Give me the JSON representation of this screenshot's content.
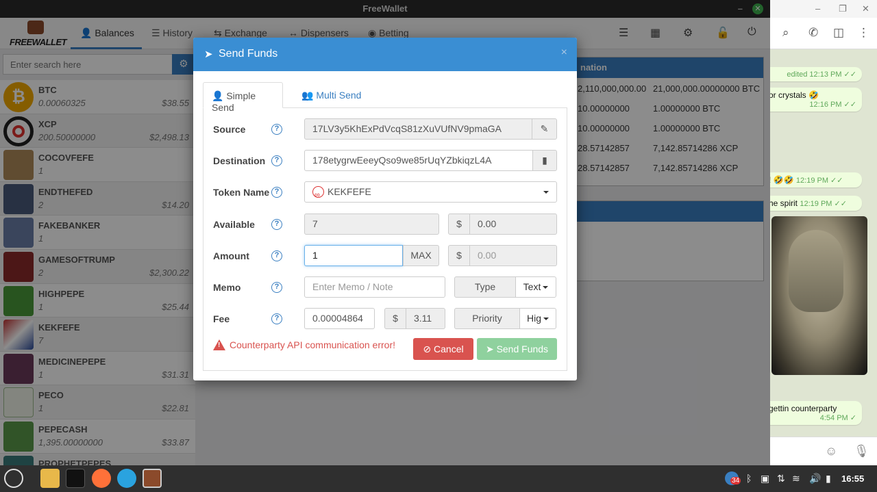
{
  "window": {
    "title": "FreeWallet"
  },
  "navbar": {
    "logo_text": "FREEWALLET",
    "tabs": [
      {
        "label": "Balances"
      },
      {
        "label": "History"
      },
      {
        "label": "Exchange"
      },
      {
        "label": "Dispensers"
      },
      {
        "label": "Betting"
      }
    ]
  },
  "sidebar": {
    "search_placeholder": "Enter search here",
    "tokens": [
      {
        "name": "BTC",
        "amount": "0.00060325",
        "usd": "$38.55",
        "color": "#f2a900"
      },
      {
        "name": "XCP",
        "amount": "200.50000000",
        "usd": "$2,498.13",
        "color": "#e0322f"
      },
      {
        "name": "COCOVFEFE",
        "amount": "1",
        "usd": "",
        "color": "#b08a5a"
      },
      {
        "name": "ENDTHEFED",
        "amount": "2",
        "usd": "$14.20",
        "color": "#4a5a7a"
      },
      {
        "name": "FAKEBANKER",
        "amount": "1",
        "usd": "",
        "color": "#6a7fa8"
      },
      {
        "name": "GAMESOFTRUMP",
        "amount": "2",
        "usd": "$2,300.22",
        "color": "#8a2a2a"
      },
      {
        "name": "HIGHPEPE",
        "amount": "1",
        "usd": "$25.44",
        "color": "#4a9a3a"
      },
      {
        "name": "KEKFEFE",
        "amount": "7",
        "usd": "",
        "color": "#c03030"
      },
      {
        "name": "MEDICINEPEPE",
        "amount": "1",
        "usd": "$31.31",
        "color": "#6a3a5a"
      },
      {
        "name": "PECO",
        "amount": "1",
        "usd": "$22.81",
        "color": "#9ab88a"
      },
      {
        "name": "PEPECASH",
        "amount": "1,395.00000000",
        "usd": "$33.87",
        "color": "#5a9a4a"
      },
      {
        "name": "PROPHETPEPES",
        "amount": "",
        "usd": "",
        "color": "#3a7a7a"
      }
    ]
  },
  "background_table": {
    "header": "nation",
    "rows": [
      [
        "2,110,000,000.00",
        "21,000,000.00000000 BTC"
      ],
      [
        "10.00000000",
        "1.00000000 BTC"
      ],
      [
        "10.00000000",
        "1.00000000 BTC"
      ],
      [
        "28.57142857",
        "7,142.85714286 XCP"
      ],
      [
        "28.57142857",
        "7,142.85714286 XCP"
      ]
    ]
  },
  "modal": {
    "title": "Send Funds",
    "close": "×",
    "tabs": {
      "simple": "Simple Send",
      "multi": "Multi Send"
    },
    "fields": {
      "source": {
        "label": "Source",
        "value": "17LV3y5KhExPdVcqS81zXuVUfNV9pmaGA"
      },
      "destination": {
        "label": "Destination",
        "value": "178etygrwEeeyQso9we85rUqYZbkiqzL4A"
      },
      "token": {
        "label": "Token Name",
        "value": "KEKFEFE"
      },
      "available": {
        "label": "Available",
        "value": "7",
        "usd": "0.00"
      },
      "amount": {
        "label": "Amount",
        "value": "1",
        "max": "MAX",
        "usd": "0.00"
      },
      "memo": {
        "label": "Memo",
        "placeholder": "Enter Memo / Note",
        "type_label": "Type",
        "type_value": "Text"
      },
      "fee": {
        "label": "Fee",
        "value": "0.00004864",
        "usd": "3.11",
        "priority_label": "Priority",
        "priority_value": "Hig"
      }
    },
    "currency_symbol": "$",
    "help_symbol": "?",
    "error": "Counterparty API communication error!",
    "cancel": "Cancel",
    "send": "Send Funds"
  },
  "chat": {
    "messages": [
      {
        "text": "",
        "meta": "edited 12:13 PM ✓✓"
      },
      {
        "text": "or crystals 🤣",
        "meta": "12:16 PM ✓✓"
      },
      {
        "text": "! 🤣🤣",
        "meta": "12:19 PM ✓✓"
      },
      {
        "text": "he spirit",
        "meta": "12:19 PM ✓✓"
      },
      {
        "text": "gettin counterparty",
        "meta": "4:54 PM ✓"
      }
    ]
  },
  "taskbar": {
    "clock": "16:55",
    "badge": "34"
  }
}
